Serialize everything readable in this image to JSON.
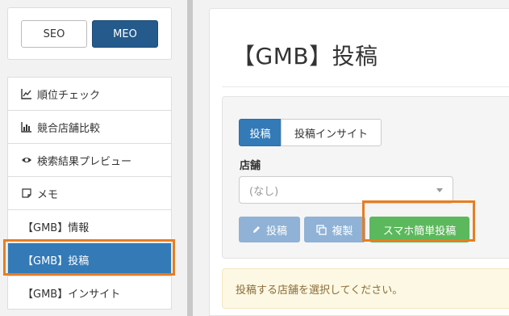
{
  "mode_switch": {
    "seo_label": "SEO",
    "meo_label": "MEO"
  },
  "menu": {
    "items": [
      {
        "label": "順位チェック",
        "icon": "line-chart-icon"
      },
      {
        "label": "競合店舗比較",
        "icon": "bar-chart-icon"
      },
      {
        "label": "検索結果プレビュー",
        "icon": "eye-icon"
      },
      {
        "label": "メモ",
        "icon": "note-icon"
      },
      {
        "label": "【GMB】情報"
      },
      {
        "label": "【GMB】投稿",
        "active": true
      },
      {
        "label": "【GMB】インサイト"
      }
    ]
  },
  "page": {
    "title": "【GMB】投稿"
  },
  "tabs": {
    "post": "投稿",
    "insight": "投稿インサイト"
  },
  "store": {
    "label": "店舗",
    "placeholder": "(なし)"
  },
  "actions": {
    "post": "投稿",
    "copy": "複製",
    "mobile_post": "スマホ簡単投稿"
  },
  "alert": {
    "message": "投稿する店舗を選択してください。"
  },
  "colors": {
    "primary": "#337ab7",
    "meo": "#245a8c",
    "success": "#5cb85c",
    "highlight": "#e67e22",
    "warning_bg": "#fcf8e3"
  }
}
